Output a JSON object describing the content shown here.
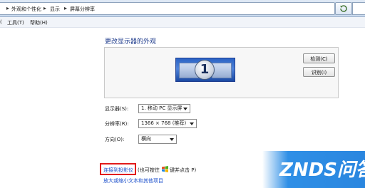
{
  "breadcrumb": {
    "items": [
      "外观和个性化",
      "显示",
      "屏幕分辨率"
    ],
    "separator": "▸"
  },
  "menu": {
    "partial_first": "(",
    "tools": "工具(T)",
    "help": "帮助(H)"
  },
  "page_title": "更改显示器的外观",
  "preview": {
    "monitor_number": "1"
  },
  "buttons": {
    "detect": "检测(C)",
    "identify": "识别(I)"
  },
  "fields": {
    "display": {
      "label": "显示器(S):",
      "value": "1. 移动 PC 显示屏"
    },
    "resolution": {
      "label": "分辨率(R):",
      "value": "1366 × 768 (推荐)"
    },
    "orientation": {
      "label": "方向(O):",
      "value": "横向"
    }
  },
  "projector": {
    "link": "连接到投影仪",
    "note": "(也可按住",
    "note_after": "键并点击 P)"
  },
  "text_size_link": "放大或缩小文本和其他项目",
  "watermark": {
    "text": "ZNDS问答"
  },
  "colors": {
    "accent": "#1e3b8c",
    "link": "#1a4ecb",
    "highlight_box": "#e21b1b",
    "watermark_bg": "#2f8fe6"
  },
  "icons": [
    "refresh-icon",
    "windows-key-icon",
    "dropdown-arrow-icon"
  ]
}
